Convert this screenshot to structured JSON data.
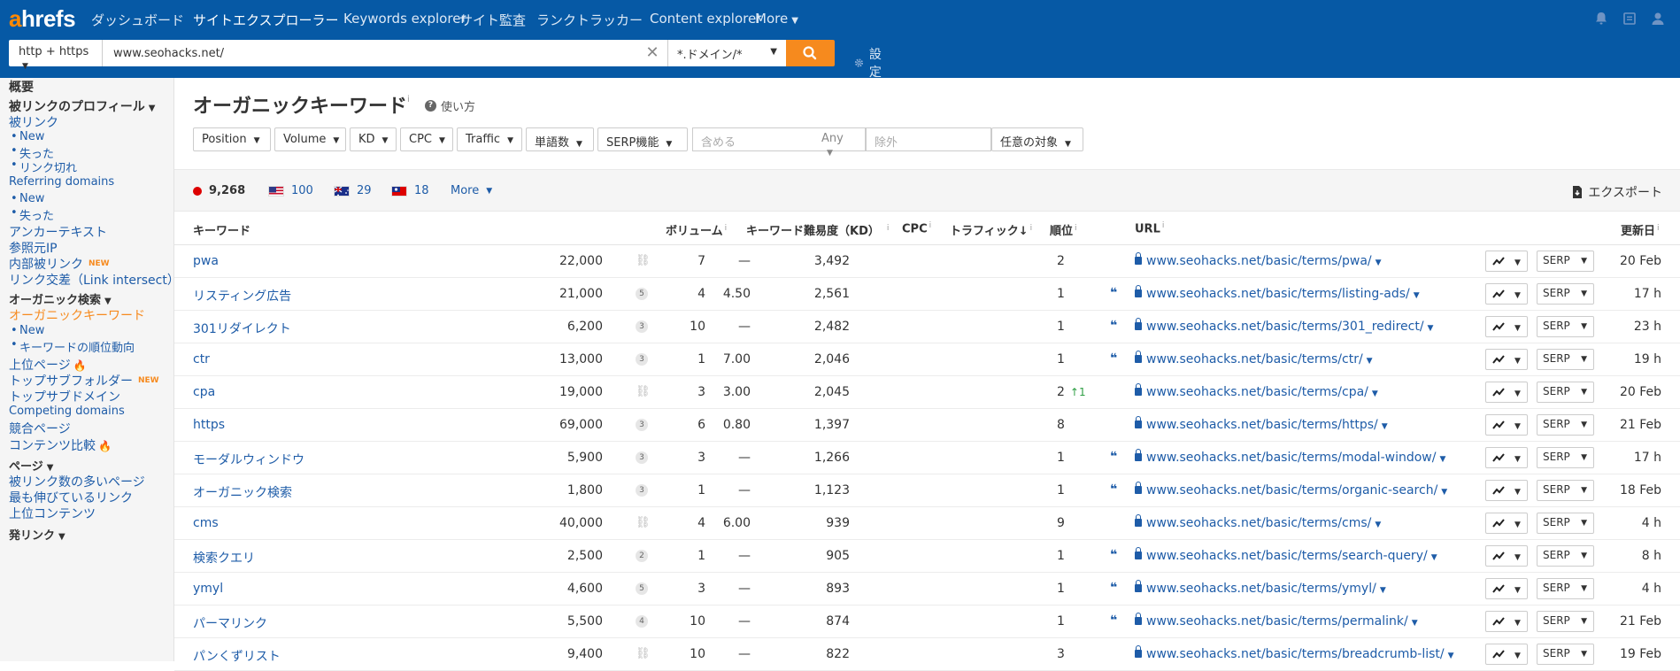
{
  "app": {
    "logo_a": "a",
    "logo_rest": "hrefs"
  },
  "nav": {
    "items": [
      {
        "label": "ダッシュボード"
      },
      {
        "label": "サイトエクスプローラー"
      },
      {
        "label": "Keywords explorer"
      },
      {
        "label": "サイト監査"
      },
      {
        "label": "ランクトラッカー"
      },
      {
        "label": "Content explorer"
      },
      {
        "label": "More"
      }
    ]
  },
  "search": {
    "protocol": "http + https",
    "url_value": "www.seohacks.net/",
    "mode": "*.ドメイン/*",
    "settings_label": "設定"
  },
  "sidebar": {
    "overview": "概要",
    "backlink_profile": "被リンクのプロフィール",
    "backlinks": "被リンク",
    "bl_new": "New",
    "bl_lost": "失った",
    "bl_broken": "リンク切れ",
    "referring_domains": "Referring domains",
    "rd_new": "New",
    "rd_lost": "失った",
    "anchors": "アンカーテキスト",
    "referring_ips": "参照元IP",
    "internal_backlinks": "内部被リンク",
    "new_badge": "NEW",
    "link_intersect": "リンク交差（Link intersect）",
    "organic_search": "オーガニック検索",
    "organic_keywords": "オーガニックキーワード",
    "ok_new": "New",
    "ok_movements": "キーワードの順位動向",
    "top_pages": "上位ページ",
    "top_subfolders": "トップサブフォルダー",
    "top_subdomains": "トップサブドメイン",
    "competing_domains": "Competing domains",
    "competing_pages": "競合ページ",
    "content_gap": "コンテンツ比較",
    "pages": "ページ",
    "best_by_links": "被リンク数の多いページ",
    "best_by_links_growth": "最も伸びているリンク",
    "top_content": "上位コンテンツ",
    "outgoing_links": "発リンク"
  },
  "main": {
    "title": "オーガニックキーワード",
    "title_info": "i",
    "help_label": "使い方",
    "filters": {
      "position": "Position",
      "volume": "Volume",
      "kd": "KD",
      "cpc": "CPC",
      "traffic": "Traffic",
      "words": "単語数",
      "serp_features": "SERP機能",
      "include_placeholder": "含める",
      "any": "Any",
      "exclude_placeholder": "除外",
      "target": "任意の対象"
    },
    "countries": {
      "jp": "9,268",
      "us": "100",
      "au": "29",
      "tw": "18",
      "more": "More"
    },
    "export_label": "エクスポート"
  },
  "table": {
    "headers": {
      "keyword": "キーワード",
      "volume": "ボリューム",
      "kd": "キーワード難易度（KD）",
      "cpc": "CPC",
      "traffic": "トラフィック",
      "position": "順位",
      "url": "URL",
      "updated": "更新日"
    },
    "info": "i",
    "sort_arrow": "↓",
    "serp_label": "SERP",
    "rows": [
      {
        "keyword": "pwa",
        "badge": "",
        "volume": "22,000",
        "kd": "7",
        "cpc": "—",
        "traffic": "3,492",
        "position": "2",
        "change": "",
        "url": "www.seohacks.net/basic/terms/pwa/",
        "featured": false,
        "updated": "20 Feb"
      },
      {
        "keyword": "リスティング広告",
        "badge": "5",
        "volume": "21,000",
        "kd": "4",
        "cpc": "4.50",
        "traffic": "2,561",
        "position": "1",
        "change": "",
        "url": "www.seohacks.net/basic/terms/listing-ads/",
        "featured": true,
        "updated": "17 h"
      },
      {
        "keyword": "301リダイレクト",
        "badge": "3",
        "volume": "6,200",
        "kd": "10",
        "cpc": "—",
        "traffic": "2,482",
        "position": "1",
        "change": "",
        "url": "www.seohacks.net/basic/terms/301_redirect/",
        "featured": true,
        "updated": "23 h"
      },
      {
        "keyword": "ctr",
        "badge": "3",
        "volume": "13,000",
        "kd": "1",
        "cpc": "7.00",
        "traffic": "2,046",
        "position": "1",
        "change": "",
        "url": "www.seohacks.net/basic/terms/ctr/",
        "featured": true,
        "updated": "19 h"
      },
      {
        "keyword": "cpa",
        "badge": "",
        "volume": "19,000",
        "kd": "3",
        "cpc": "3.00",
        "traffic": "2,045",
        "position": "2",
        "change": "↑1",
        "url": "www.seohacks.net/basic/terms/cpa/",
        "featured": false,
        "updated": "20 Feb"
      },
      {
        "keyword": "https",
        "badge": "3",
        "volume": "69,000",
        "kd": "6",
        "cpc": "0.80",
        "traffic": "1,397",
        "position": "8",
        "change": "",
        "url": "www.seohacks.net/basic/terms/https/",
        "featured": false,
        "updated": "21 Feb"
      },
      {
        "keyword": "モーダルウィンドウ",
        "badge": "3",
        "volume": "5,900",
        "kd": "3",
        "cpc": "—",
        "traffic": "1,266",
        "position": "1",
        "change": "",
        "url": "www.seohacks.net/basic/terms/modal-window/",
        "featured": true,
        "updated": "17 h"
      },
      {
        "keyword": "オーガニック検索",
        "badge": "3",
        "volume": "1,800",
        "kd": "1",
        "cpc": "—",
        "traffic": "1,123",
        "position": "1",
        "change": "",
        "url": "www.seohacks.net/basic/terms/organic-search/",
        "featured": true,
        "updated": "18 Feb"
      },
      {
        "keyword": "cms",
        "badge": "",
        "volume": "40,000",
        "kd": "4",
        "cpc": "6.00",
        "traffic": "939",
        "position": "9",
        "change": "",
        "url": "www.seohacks.net/basic/terms/cms/",
        "featured": false,
        "updated": "4 h"
      },
      {
        "keyword": "検索クエリ",
        "badge": "2",
        "volume": "2,500",
        "kd": "1",
        "cpc": "—",
        "traffic": "905",
        "position": "1",
        "change": "",
        "url": "www.seohacks.net/basic/terms/search-query/",
        "featured": true,
        "updated": "8 h"
      },
      {
        "keyword": "ymyl",
        "badge": "5",
        "volume": "4,600",
        "kd": "3",
        "cpc": "—",
        "traffic": "893",
        "position": "1",
        "change": "",
        "url": "www.seohacks.net/basic/terms/ymyl/",
        "featured": true,
        "updated": "4 h"
      },
      {
        "keyword": "パーマリンク",
        "badge": "4",
        "volume": "5,500",
        "kd": "10",
        "cpc": "—",
        "traffic": "874",
        "position": "1",
        "change": "",
        "url": "www.seohacks.net/basic/terms/permalink/",
        "featured": true,
        "updated": "21 Feb"
      },
      {
        "keyword": "パンくずリスト",
        "badge": "",
        "volume": "9,400",
        "kd": "10",
        "cpc": "—",
        "traffic": "822",
        "position": "3",
        "change": "",
        "url": "www.seohacks.net/basic/terms/breadcrumb-list/",
        "featured": false,
        "updated": "19 Feb"
      }
    ]
  },
  "colors": {
    "topbar": "#0659a5",
    "accent": "#f68a1e",
    "link": "#1e5ca8"
  }
}
